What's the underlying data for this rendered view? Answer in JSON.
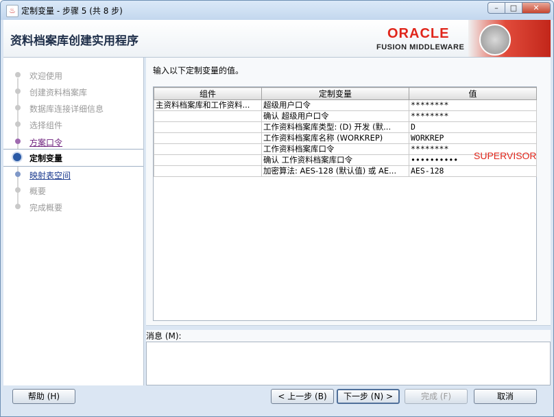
{
  "window": {
    "title": "定制变量 - 步骤 5 (共 8 步)",
    "minimize_glyph": "–",
    "maximize_glyph": "□",
    "close_glyph": "✕",
    "app_icon_glyph": "♨"
  },
  "header": {
    "app_title": "资料档案库创建实用程序",
    "brand": "ORACLE",
    "brand_sub": "FUSION MIDDLEWARE"
  },
  "nav": {
    "items": [
      {
        "label": "欢迎使用",
        "state": "done"
      },
      {
        "label": "创建资料档案库",
        "state": "done"
      },
      {
        "label": "数据库连接详细信息",
        "state": "done"
      },
      {
        "label": "选择组件",
        "state": "done"
      },
      {
        "label": "方案口令",
        "state": "visited"
      },
      {
        "label": "定制变量",
        "state": "current"
      },
      {
        "label": "映射表空间",
        "state": "link"
      },
      {
        "label": "概要",
        "state": "pending"
      },
      {
        "label": "完成概要",
        "state": "pending"
      }
    ]
  },
  "main": {
    "instruction": "输入以下定制变量的值。",
    "columns": [
      "组件",
      "定制变量",
      "值"
    ],
    "rows": [
      {
        "component": "主资料档案库和工作资料...",
        "variable": "超级用户口令",
        "value": "********"
      },
      {
        "component": "",
        "variable": "确认 超级用户口令",
        "value": "********"
      },
      {
        "component": "",
        "variable": "工作资料档案库类型: (D) 开发 (默...",
        "value": "D"
      },
      {
        "component": "",
        "variable": "工作资料档案库名称 (WORKREP)",
        "value": "WORKREP"
      },
      {
        "component": "",
        "variable": "工作资料档案库口令",
        "value": "********"
      },
      {
        "component": "",
        "variable": "确认 工作资料档案库口令",
        "value": "••••••••••"
      },
      {
        "component": "",
        "variable": "加密算法: AES-128 (默认值) 或 AE...",
        "value": "AES-128"
      }
    ],
    "annotation": "SUPERVISOR",
    "messages_label": "消息 (M):"
  },
  "footer": {
    "help": "帮助 (H)",
    "back": "< 上一步 (B)",
    "next": "下一步 (N) >",
    "finish": "完成 (F)",
    "cancel": "取消"
  },
  "colors": {
    "accent_red": "#e0261b",
    "link_blue": "#1b3b8f",
    "window_bg": "#dbe6f3"
  }
}
